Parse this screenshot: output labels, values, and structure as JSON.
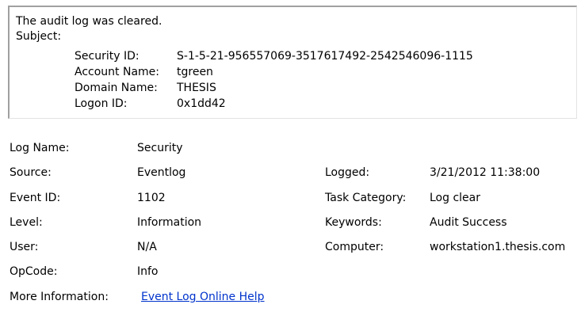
{
  "description": {
    "line1": "The audit log was cleared.",
    "subject_label": "Subject:",
    "fields": [
      {
        "label": "Security ID:",
        "value": "S-1-5-21-956557069-3517617492-2542546096-1115"
      },
      {
        "label": "Account Name:",
        "value": "tgreen"
      },
      {
        "label": "Domain Name:",
        "value": "THESIS"
      },
      {
        "label": "Logon ID:",
        "value": "0x1dd42"
      }
    ]
  },
  "details": {
    "log_name": {
      "label": "Log Name:",
      "value": "Security"
    },
    "source": {
      "label": "Source:",
      "value": "Eventlog"
    },
    "logged": {
      "label": "Logged:",
      "value": "3/21/2012 11:38:00"
    },
    "event_id": {
      "label": "Event ID:",
      "value": "1102"
    },
    "task_category": {
      "label": "Task Category:",
      "value": "Log clear"
    },
    "level": {
      "label": "Level:",
      "value": "Information"
    },
    "keywords": {
      "label": "Keywords:",
      "value": "Audit Success"
    },
    "user": {
      "label": "User:",
      "value": "N/A"
    },
    "computer": {
      "label": "Computer:",
      "value": "workstation1.thesis.com"
    },
    "opcode": {
      "label": "OpCode:",
      "value": "Info"
    },
    "more_info": {
      "label": "More Information:",
      "link_text": "Event Log Online Help"
    }
  }
}
